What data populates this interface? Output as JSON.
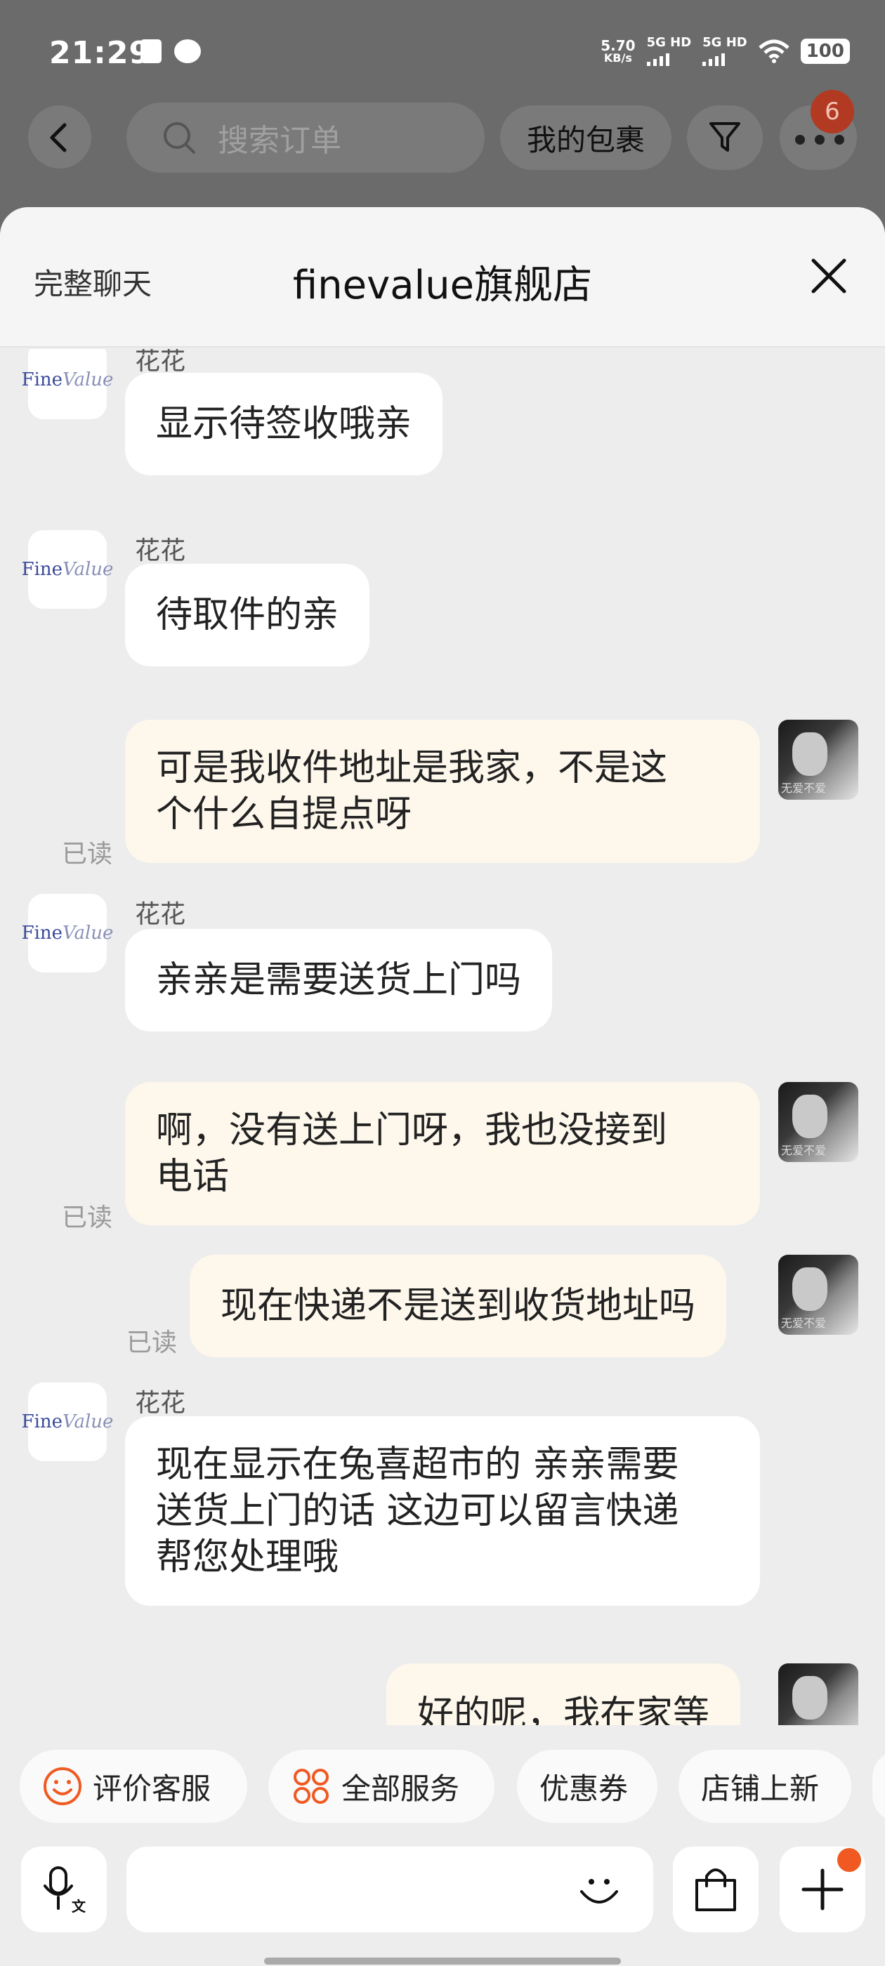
{
  "status_bar": {
    "time": "21:29",
    "speed_value": "5.70",
    "speed_unit": "KB/s",
    "sim1": "5G HD",
    "sim2": "5G HD",
    "battery": "100"
  },
  "background_nav": {
    "search_placeholder": "搜索订单",
    "my_packages": "我的包裹",
    "more_badge": "6"
  },
  "chat": {
    "full_chat_label": "完整聊天",
    "shop_name": "finevalue旗舰店",
    "store_logo": {
      "fine": "Fine",
      "value": "Value"
    },
    "user_avatar_caption": "无爱不爱",
    "read_label": "已读",
    "messages": [
      {
        "from": "store",
        "sender": "花花",
        "text": "显示待签收哦亲"
      },
      {
        "from": "store",
        "sender": "花花",
        "text": "待取件的亲"
      },
      {
        "from": "me",
        "text_line1": "可是我收件地址是我家，不是这",
        "text_line2": "个什么自提点呀",
        "status": "已读"
      },
      {
        "from": "store",
        "sender": "花花",
        "text": "亲亲是需要送货上门吗"
      },
      {
        "from": "me",
        "text_line1": "啊，没有送上门呀，我也没接到",
        "text_line2": "电话",
        "status": "已读"
      },
      {
        "from": "me",
        "text": "现在快递不是送到收货地址吗",
        "status": "已读"
      },
      {
        "from": "store",
        "sender": "花花",
        "text_line1": "现在显示在兔喜超市的 亲亲需要",
        "text_line2": "送货上门的话 这边可以留言快递",
        "text_line3": "帮您处理哦"
      },
      {
        "from": "me",
        "text": "好的呢，我在家等"
      }
    ]
  },
  "quick_actions": [
    "评价客服",
    "全部服务",
    "优惠券",
    "店铺上新"
  ],
  "icons": {
    "voice": "microphone-translate-icon",
    "emoji": "smile-icon",
    "bag": "shopping-bag-icon",
    "plus": "plus-icon"
  },
  "colors": {
    "store_bubble": "#ffffff",
    "my_bubble": "#fdf7ec",
    "accent_orange": "#f05a22",
    "sheet_bg": "#ededed"
  }
}
